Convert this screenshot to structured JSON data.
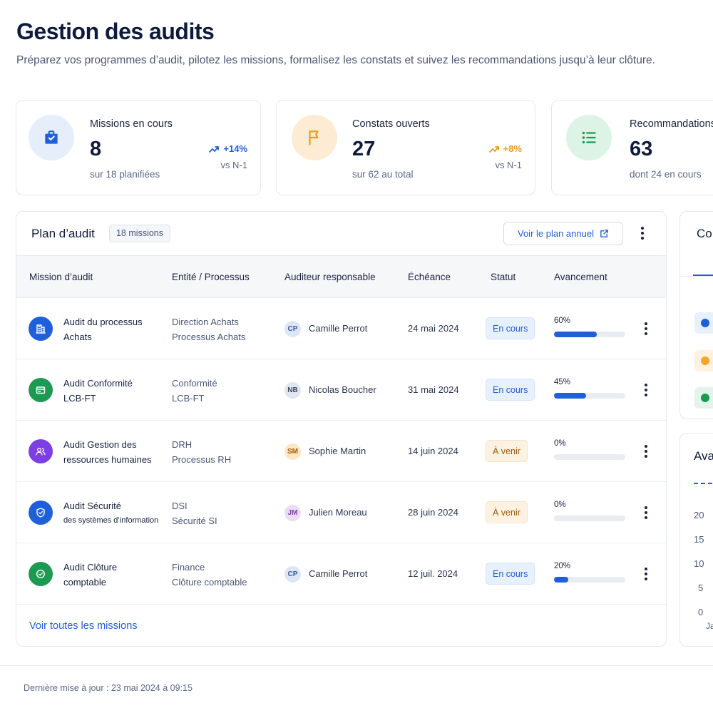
{
  "header": {
    "title": "Gestion des audits",
    "subtitle": "Préparez vos programmes d’audit, pilotez les missions, formalisez les constats et suivez les recommandations jusqu’à leur clôture."
  },
  "kpis": [
    {
      "label": "Missions en cours",
      "value": "8",
      "sub": "sur 18 planifiées",
      "trend": "+14%",
      "vs": "vs N-1",
      "icon": "briefcase-icon",
      "icon_bg": "#e6eefc",
      "icon_color": "#1f5fd9",
      "trend_color": "#1f5fd9"
    },
    {
      "label": "Constats ouverts",
      "value": "27",
      "sub": "sur 62 au total",
      "trend": "+8%",
      "vs": "vs N-1",
      "icon": "flag-icon",
      "icon_bg": "#fdecd3",
      "icon_color": "#f09a1a",
      "trend_color": "#f09a1a"
    },
    {
      "label": "Recommandations",
      "value": "63",
      "sub": "dont 24 en cours",
      "icon": "list-icon",
      "icon_bg": "#ddf3e5",
      "icon_color": "#1d9a52"
    }
  ],
  "plan": {
    "title": "Plan d’audit",
    "count": "18 missions",
    "annual_button": "Voir le plan annuel",
    "columns": [
      "Mission d’audit",
      "Entité / Processus",
      "Auditeur responsable",
      "Échéance",
      "Statut",
      "Avancement"
    ],
    "rows": [
      {
        "mission1": "Audit du processus",
        "mission2": "Achats",
        "entity1": "Direction Achats",
        "entity2": "Processus Achats",
        "initials": "CP",
        "auditor": "Camille Perrot",
        "due": "24 mai 2024",
        "status": "En cours",
        "progress": "60%",
        "progress_value": 0.6,
        "icon": "building-icon",
        "icon_bg": "#1f5fd9"
      },
      {
        "mission1": "Audit Conformité",
        "mission2": "LCB-FT",
        "entity1": "Conformité",
        "entity2": "LCB-FT",
        "initials": "NB",
        "auditor": "Nicolas Boucher",
        "due": "31 mai 2024",
        "status": "En cours",
        "progress": "45%",
        "progress_value": 0.45,
        "icon": "card-icon",
        "icon_bg": "#1d9a52"
      },
      {
        "mission1": "Audit Gestion des",
        "mission2": "ressources humaines",
        "entity1": "DRH",
        "entity2": "Processus RH",
        "initials": "SM",
        "auditor": "Sophie Martin",
        "due": "14 juin 2024",
        "status": "À venir",
        "progress": "0%",
        "progress_value": 0,
        "icon": "users-icon",
        "icon_bg": "#7b3fe4"
      },
      {
        "mission1": "Audit Sécurité",
        "mission2": "des systèmes d’information",
        "entity1": "DSI",
        "entity2": "Sécurité SI",
        "initials": "JM",
        "auditor": "Julien Moreau",
        "due": "28 juin 2024",
        "status": "À venir",
        "progress": "0%",
        "progress_value": 0,
        "icon": "shield-icon",
        "icon_bg": "#1f5fd9"
      },
      {
        "mission1": "Audit Clôture",
        "mission2": "comptable",
        "entity1": "Finance",
        "entity2": "Clôture comptable",
        "initials": "CP",
        "auditor": "Camille Perrot",
        "due": "12 juil. 2024",
        "status": "En cours",
        "progress": "20%",
        "progress_value": 0.2,
        "icon": "check-circle-icon",
        "icon_bg": "#1d9a52"
      }
    ],
    "link": "Voir toutes les missions"
  },
  "side_panel_1": {
    "title": "Co",
    "items": [
      {
        "dot_color": "#1f5fd9",
        "bg": "#e7f0fd"
      },
      {
        "dot_color": "#f5a623",
        "bg": "#fdf2e2"
      },
      {
        "dot_color": "#1d9a52",
        "bg": "#e3f5ea"
      }
    ]
  },
  "side_panel_2": {
    "title": "Ava",
    "y_ticks": [
      "20",
      "15",
      "10",
      "5",
      "0"
    ],
    "x_label": "Ja"
  },
  "footer": {
    "updated": "Dernière mise à jour : 23 mai 2024 à 09:15"
  }
}
